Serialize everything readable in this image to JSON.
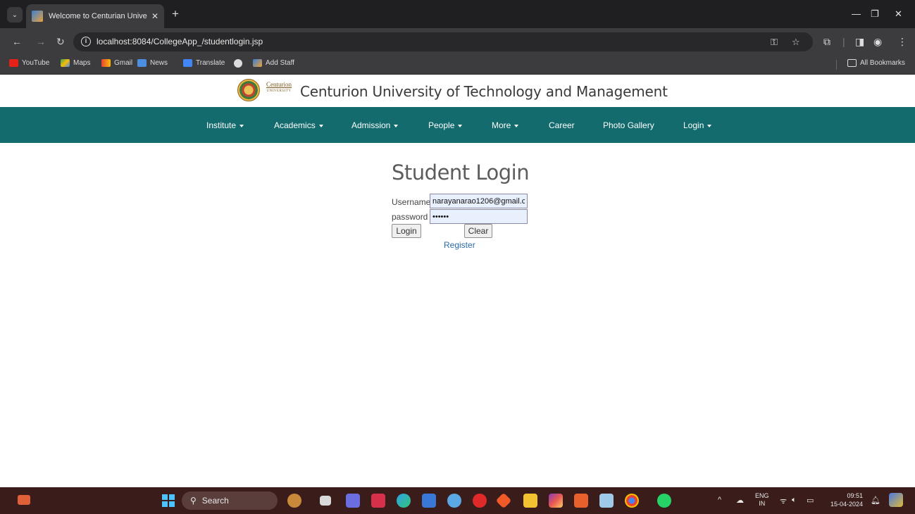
{
  "browser": {
    "tab_title": "Welcome to Centurian Universi",
    "url": "localhost:8084/CollegeApp_/studentlogin.jsp",
    "bookmarks": [
      "YouTube",
      "Maps",
      "Gmail",
      "News",
      "Translate",
      "Add Staff"
    ],
    "all_bookmarks": "All Bookmarks"
  },
  "site": {
    "logo_line1": "Centurion",
    "logo_line2": "UNIVERSITY",
    "title": "Centurion University of Technology and Management"
  },
  "nav": {
    "items": [
      {
        "label": "Institute",
        "dropdown": true
      },
      {
        "label": "Academics",
        "dropdown": true
      },
      {
        "label": "Admission",
        "dropdown": true
      },
      {
        "label": "People",
        "dropdown": true
      },
      {
        "label": "More",
        "dropdown": true
      },
      {
        "label": "Career",
        "dropdown": false
      },
      {
        "label": "Photo Gallery",
        "dropdown": false
      },
      {
        "label": "Login",
        "dropdown": true
      }
    ]
  },
  "login": {
    "heading": "Student Login",
    "username_label": "Username",
    "username_value": "narayanarao1206@gmail.c",
    "password_label": "password",
    "password_value": "••••••",
    "login_button": "Login",
    "clear_button": "Clear",
    "register_link": "Register"
  },
  "taskbar": {
    "search_label": "Search",
    "lang_line1": "ENG",
    "lang_line2": "IN",
    "time": "09:51",
    "date": "15-04-2024"
  },
  "colors": {
    "navbar": "#136b6d",
    "link": "#2a6aa8",
    "input_bg": "#e8f0fe",
    "taskbar": "#3a1d1b"
  }
}
